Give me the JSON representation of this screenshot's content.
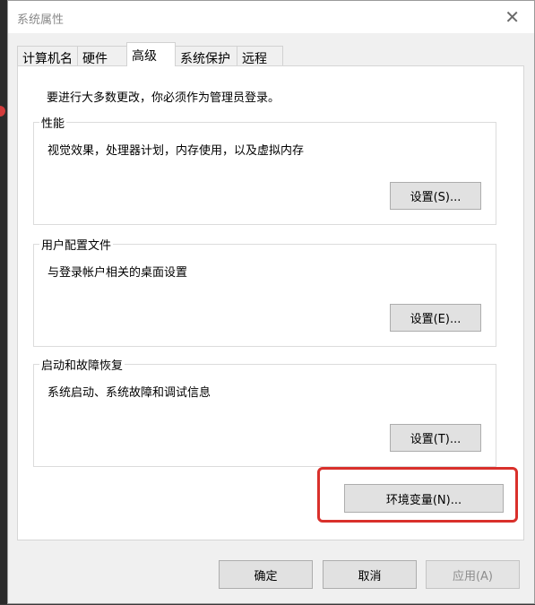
{
  "window": {
    "title": "系统属性",
    "close_symbol": "✕"
  },
  "tabs": [
    {
      "label": "计算机名"
    },
    {
      "label": "硬件"
    },
    {
      "label": "高级"
    },
    {
      "label": "系统保护"
    },
    {
      "label": "远程"
    }
  ],
  "active_tab": "高级",
  "notice": "要进行大多数更改，你必须作为管理员登录。",
  "groups": {
    "performance": {
      "title": "性能",
      "description": "视觉效果，处理器计划，内存使用，以及虚拟内存",
      "button": "设置(S)..."
    },
    "user_profiles": {
      "title": "用户配置文件",
      "description": "与登录帐户相关的桌面设置",
      "button": "设置(E)..."
    },
    "startup_recovery": {
      "title": "启动和故障恢复",
      "description": "系统启动、系统故障和调试信息",
      "button": "设置(T)..."
    }
  },
  "env_button": "环境变量(N)...",
  "highlight_color": "#d9302b",
  "footer": {
    "ok": "确定",
    "cancel": "取消",
    "apply": "应用(A)"
  }
}
